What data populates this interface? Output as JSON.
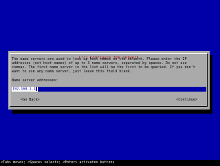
{
  "dialog": {
    "title": "[!!] Configure the network",
    "description_lines": [
      "The name servers are used to look up host names on the network. Please enter the IP",
      "addresses (not host names) of up to 3 name servers, separated by spaces. Do not use",
      "commas. The first name server in the list will be the first to be queried. If you don't",
      "want to use any name server, just leave this field blank."
    ],
    "field_label": "Name server addresses:",
    "field_value": "192.168.1.1",
    "back_button": "<Go Back>",
    "continue_button": "<Continue>"
  },
  "statusbar": {
    "text": "<Tab> moves; <Space> selects; <Enter> activates buttons"
  },
  "colors": {
    "background": "#0000a8",
    "dialog": "#aaaaaa",
    "title": "#aa0000",
    "field": "#0000a8"
  }
}
